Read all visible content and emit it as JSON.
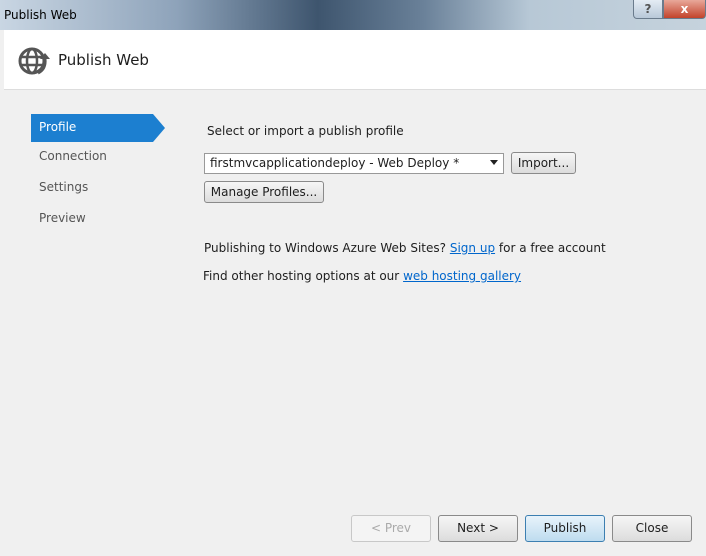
{
  "window": {
    "title": "Publish Web",
    "help_label": "?",
    "close_label": "x"
  },
  "header": {
    "title": "Publish Web",
    "icon": "globe-publish-icon"
  },
  "nav": {
    "items": [
      {
        "label": "Profile",
        "active": true
      },
      {
        "label": "Connection"
      },
      {
        "label": "Settings"
      },
      {
        "label": "Preview"
      }
    ]
  },
  "profile": {
    "heading": "Select or import a publish profile",
    "selected_profile": "firstmvcapplicationdeploy - Web Deploy *",
    "import_label": "Import...",
    "manage_label": "Manage Profiles...",
    "azure_text": "Publishing to Windows Azure Web Sites?",
    "signup_link": "Sign up",
    "azure_suffix": "for a free account",
    "hosting_text": "Find other hosting options at our",
    "hosting_link": "web hosting gallery"
  },
  "footer": {
    "prev": "< Prev",
    "next": "Next >",
    "publish": "Publish",
    "close": "Close"
  }
}
